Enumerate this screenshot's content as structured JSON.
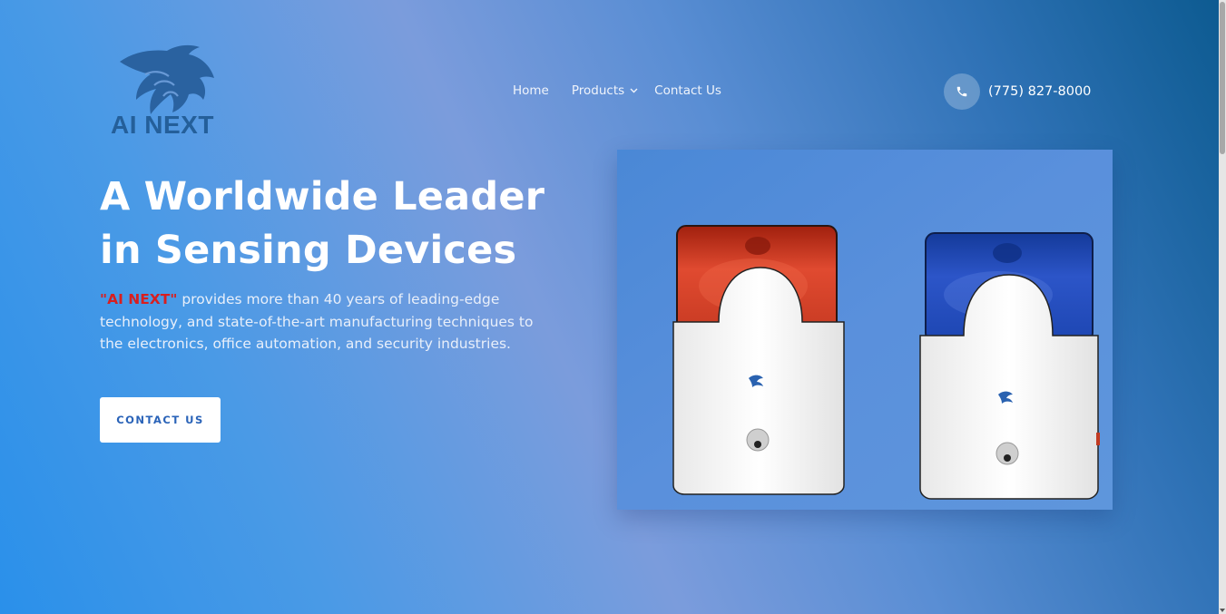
{
  "brand": {
    "name": "AI NEXT",
    "logo_icon": "cougar-head-logo",
    "brand_color": "#245f9a"
  },
  "nav": {
    "items": [
      {
        "label": "Home"
      },
      {
        "label": "Products",
        "has_dropdown": true
      },
      {
        "label": "Contact Us"
      }
    ]
  },
  "phone": {
    "icon": "phone-icon",
    "number": "(775) 827-8000"
  },
  "hero": {
    "title": "A Worldwide Leader in Sensing Devices",
    "brand_quote": "\"AI NEXT\"",
    "description": " provides more than 40 years of leading-edge technology, and state-of-the-art manufacturing techniques to the electronics, office automation, and security industries.",
    "cta_label": "CONTACT US",
    "cta_color": "#2a63b8",
    "quote_color": "#d81f1f"
  },
  "product_image": {
    "subject": "two-strobe-siren-sensors",
    "left_lens_color": "#d23a24",
    "right_lens_color": "#1f47b8"
  }
}
